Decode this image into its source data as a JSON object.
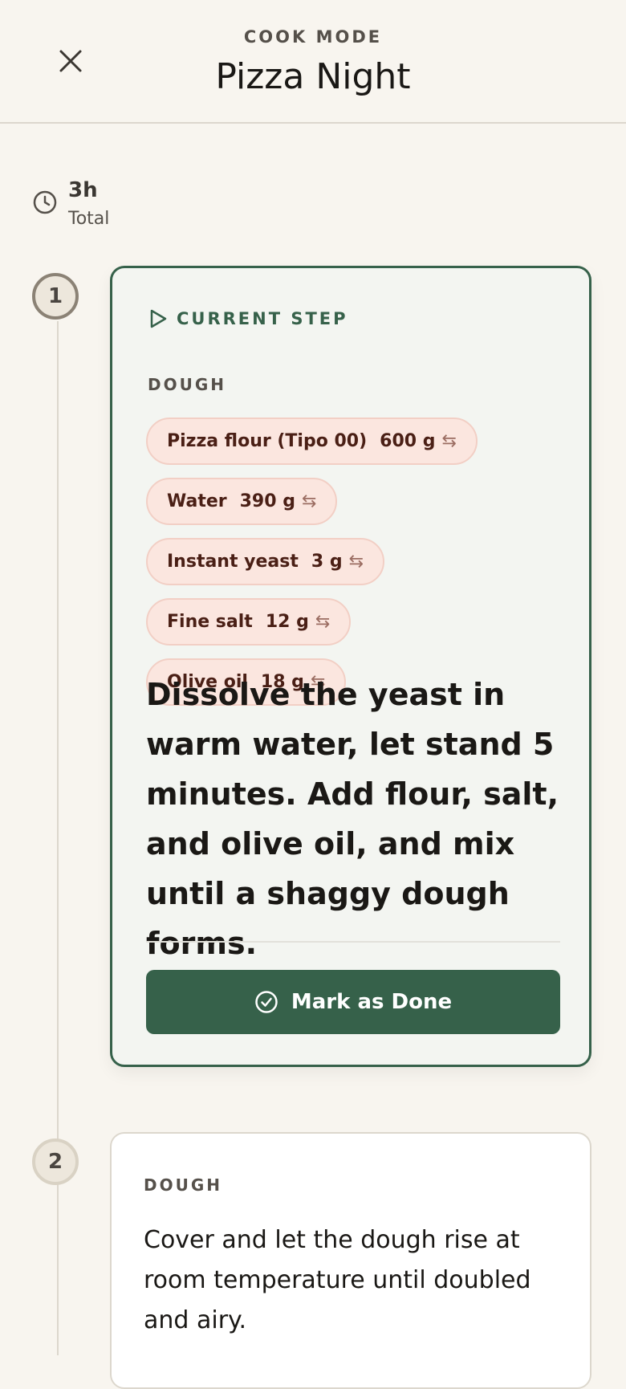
{
  "header": {
    "mode_label": "COOK MODE",
    "title": "Pizza Night",
    "close_icon": "close-icon"
  },
  "summary": {
    "time_icon": "clock-icon",
    "time_value": "3h",
    "time_label": "Total"
  },
  "steps": [
    {
      "number": "1",
      "status_label": "CURRENT STEP",
      "status_icon": "play-outline-icon",
      "section": "DOUGH",
      "ingredients": [
        {
          "name": "Pizza flour (Tipo 00)",
          "amount": "600 g",
          "swap_icon": "⇆"
        },
        {
          "name": "Water",
          "amount": "390 g",
          "swap_icon": "⇆"
        },
        {
          "name": "Instant yeast",
          "amount": "3 g",
          "swap_icon": "⇆"
        },
        {
          "name": "Fine salt",
          "amount": "12 g",
          "swap_icon": "⇆"
        },
        {
          "name": "Olive oil",
          "amount": "18 g",
          "swap_icon": "⇆"
        }
      ],
      "instruction": "Dissolve the yeast in warm water, let stand 5 minutes. Add flour, salt, and olive oil, and mix until a shaggy dough forms.",
      "done_button": "Mark as Done"
    },
    {
      "number": "2",
      "section": "DOUGH",
      "instruction": "Cover and let the dough rise at room temperature until doubled and airy."
    }
  ],
  "colors": {
    "accent": "#36614a",
    "chip_bg": "#fbe6df",
    "background": "#f8f5ef"
  }
}
